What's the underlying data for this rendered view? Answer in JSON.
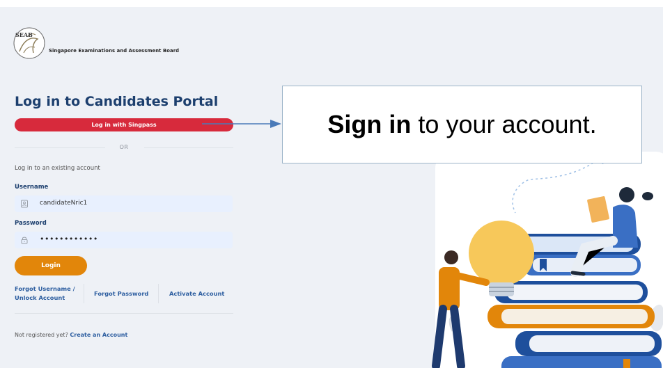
{
  "header": {
    "logo_text": "SEAB",
    "board_name": "Singapore Examinations and Assessment Board"
  },
  "login": {
    "title": "Log in to Candidates Portal",
    "singpass_label": "Log in with Singpass",
    "or_label": "OR",
    "existing_label": "Log in to an existing account",
    "username_label": "Username",
    "username_value": "candidateNric1",
    "password_label": "Password",
    "password_value": "••••••••••••",
    "login_label": "Login",
    "forgot_username_line1": "Forgot Username /",
    "forgot_username_line2": "Unlock Account",
    "forgot_password": "Forgot Password",
    "activate_account": "Activate Account",
    "not_registered": "Not registered yet?",
    "create_account": "Create an Account"
  },
  "callout": {
    "bold": "Sign in",
    "rest": "to your account."
  },
  "icons": {
    "username": "user-card-icon",
    "password": "lock-icon"
  },
  "colors": {
    "primary_text": "#1c3f6e",
    "singpass": "#d72a3c",
    "login": "#e2860a",
    "link": "#2d5ea0",
    "field_bg": "#e8f0fe",
    "page_bg": "#eef1f6"
  }
}
